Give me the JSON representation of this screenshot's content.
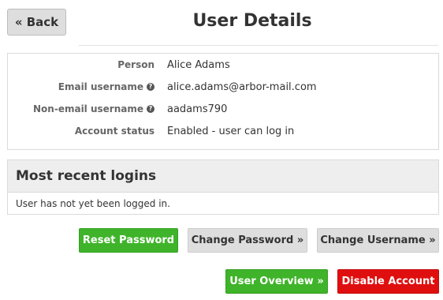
{
  "header": {
    "back_label": "« Back",
    "title": "User Details"
  },
  "details": {
    "person": {
      "label": "Person",
      "value": "Alice Adams"
    },
    "email_username": {
      "label": "Email username",
      "value": "alice.adams@arbor-mail.com",
      "help_icon": "?"
    },
    "non_email_username": {
      "label": "Non-email username",
      "value": "aadams790",
      "help_icon": "?"
    },
    "account_status": {
      "label": "Account status",
      "value": "Enabled - user can log in"
    }
  },
  "logins": {
    "heading": "Most recent logins",
    "empty_text": "User has not yet been logged in."
  },
  "actions": {
    "reset_password": "Reset Password",
    "change_password": "Change Password »",
    "change_username": "Change Username »",
    "user_overview": "User Overview »",
    "disable_account": "Disable Account"
  },
  "colors": {
    "green": "#3fb42a",
    "red": "#e00f0f",
    "gray_button": "#dedede"
  }
}
